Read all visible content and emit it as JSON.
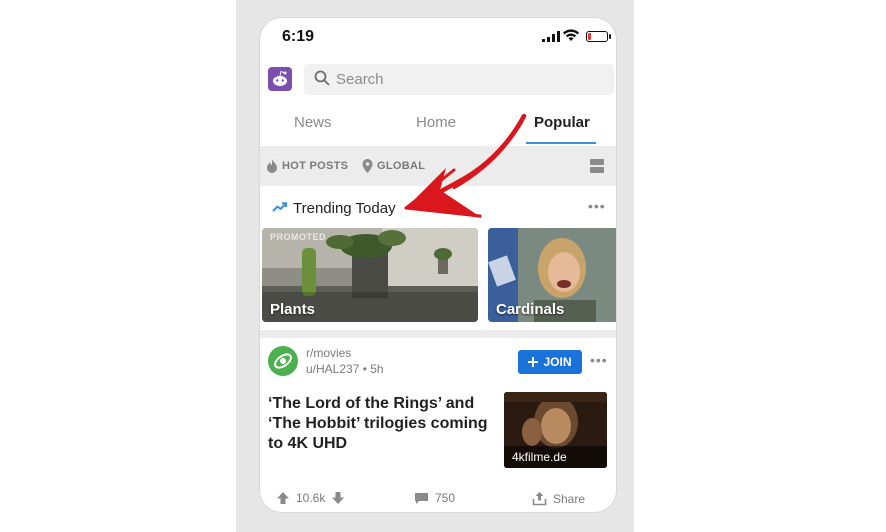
{
  "status_bar": {
    "time": "6:19"
  },
  "search": {
    "placeholder": "Search"
  },
  "tabs": [
    {
      "label": "News"
    },
    {
      "label": "Home"
    },
    {
      "label": "Popular",
      "active": true
    }
  ],
  "sort_bar": {
    "sort_label": "HOT POSTS",
    "location_label": "GLOBAL"
  },
  "trending": {
    "title": "Trending Today",
    "cards": [
      {
        "label": "Plants",
        "badge": "PROMOTED"
      },
      {
        "label": "Cardinals"
      }
    ]
  },
  "post": {
    "subreddit": "r/movies",
    "meta": "u/HAL237 • 5h",
    "join_label": "JOIN",
    "title": "‘The Lord of the Rings’ and ‘The Hobbit’ trilogies coming to 4K UHD",
    "thumbnail_caption": "4kfilme.de",
    "score": "10.6k",
    "comments": "750",
    "share_label": "Share"
  },
  "colors": {
    "accent": "#3d8fd8",
    "join_button": "#1a73d9",
    "annotation_arrow": "#d9171d",
    "battery_low": "#e53935"
  }
}
